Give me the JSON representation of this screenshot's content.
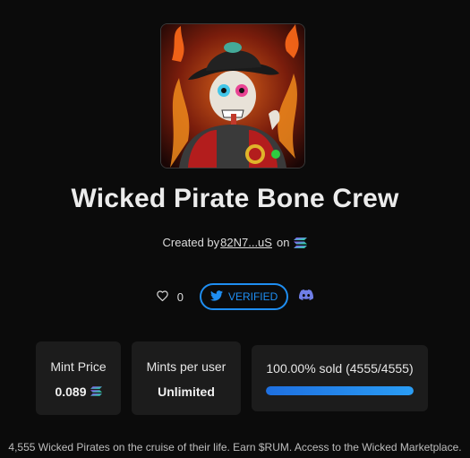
{
  "collection": {
    "title": "Wicked Pirate Bone Crew",
    "created_by_label": "Created by",
    "creator_address": "82N7...uS",
    "on_label": "on",
    "chain_icon": "solana-icon",
    "description": "4,555 Wicked Pirates on the cruise of their life. Earn $RUM. Access to the Wicked Marketplace."
  },
  "social": {
    "likes": "0",
    "verified_label": "VERIFIED",
    "verified_icon": "twitter-icon",
    "discord_icon": "discord-icon"
  },
  "stats": {
    "mint_price_label": "Mint Price",
    "mint_price_value": "0.089",
    "mints_per_user_label": "Mints per user",
    "mints_per_user_value": "Unlimited",
    "sold_label": "100.00% sold (4555/4555)",
    "sold_fraction": 1.0
  },
  "colors": {
    "accent": "#1f8ef1",
    "background": "#0b0b0b",
    "card": "#1c1c1c"
  }
}
